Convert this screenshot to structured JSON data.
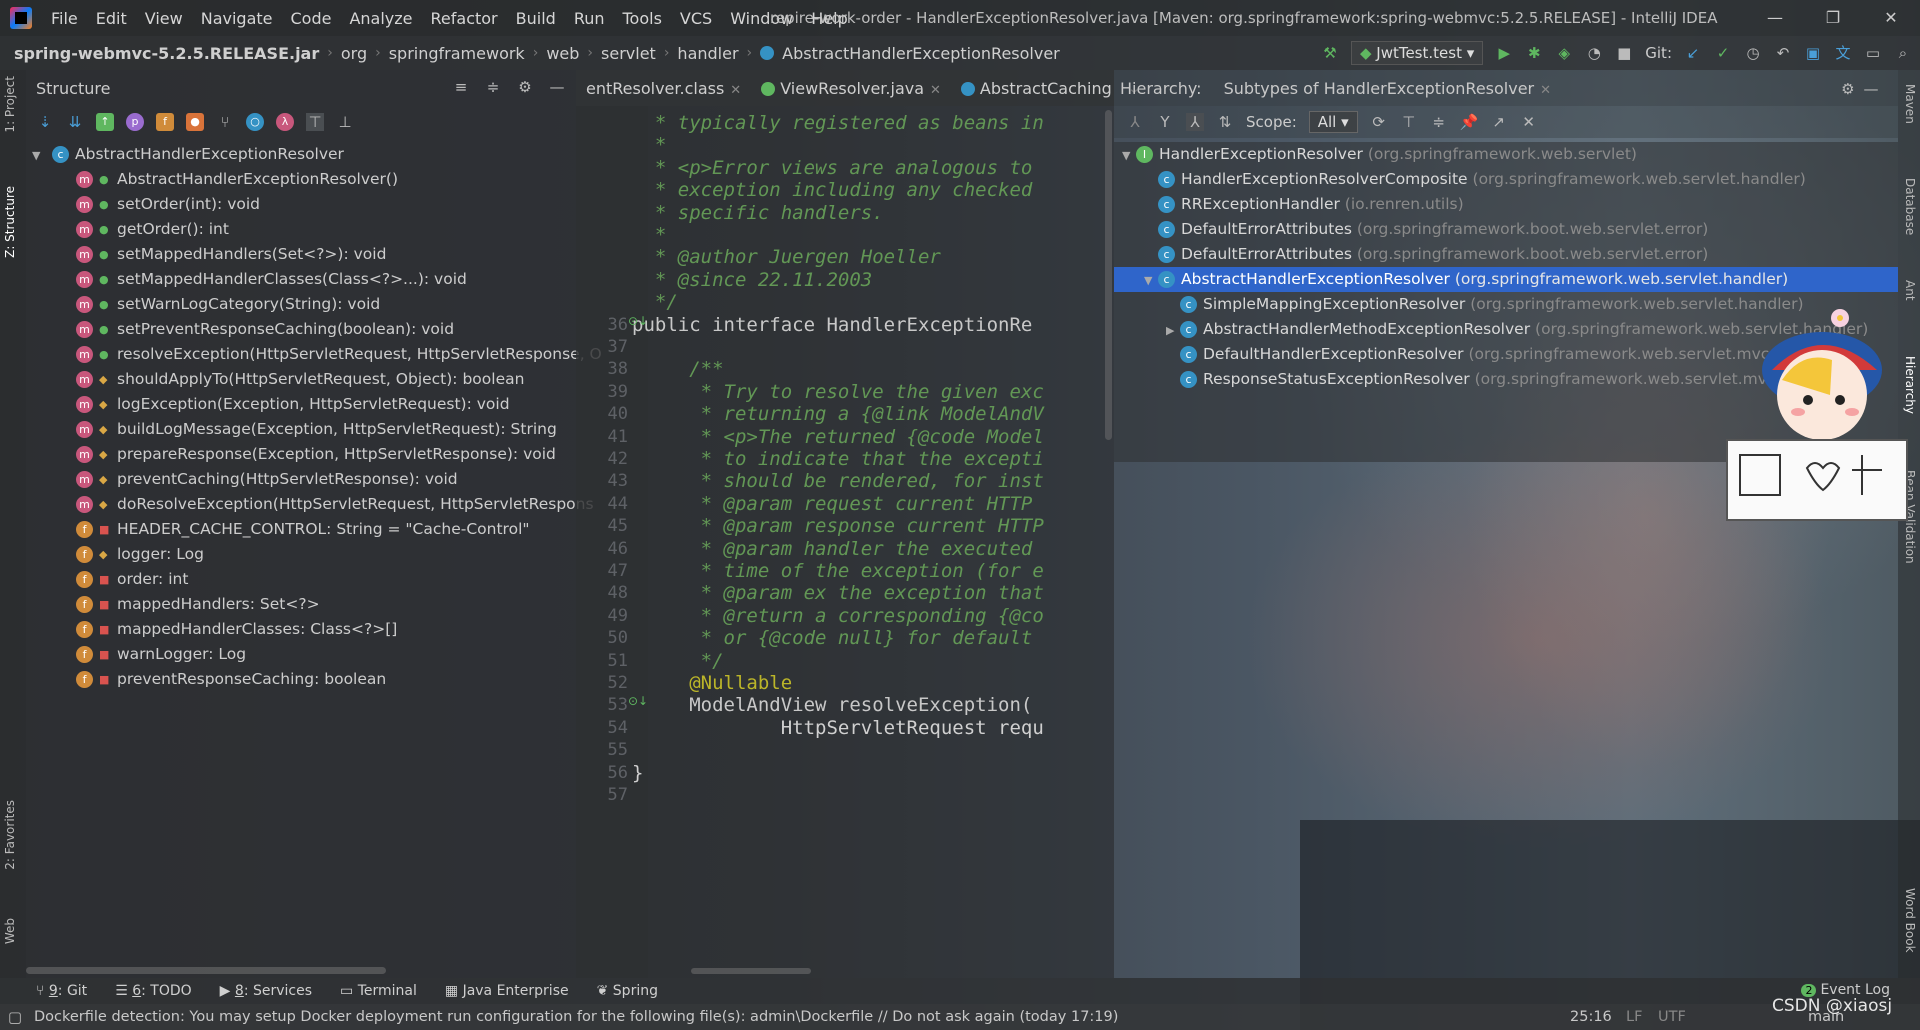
{
  "window": {
    "title": "repire-work-order - HandlerExceptionResolver.java [Maven: org.springframework:spring-webmvc:5.2.5.RELEASE] - IntelliJ IDEA",
    "controls": [
      "—",
      "❐",
      "✕"
    ]
  },
  "menu": [
    "File",
    "Edit",
    "View",
    "Navigate",
    "Code",
    "Analyze",
    "Refactor",
    "Build",
    "Run",
    "Tools",
    "VCS",
    "Window",
    "Help"
  ],
  "breadcrumb": [
    "spring-webmvc-5.2.5.RELEASE.jar",
    "org",
    "springframework",
    "web",
    "servlet",
    "handler",
    "AbstractHandlerExceptionResolver"
  ],
  "toolbar": {
    "run_config": "JwtTest.test",
    "git_label": "Git:"
  },
  "left_stripe": {
    "project": "1: Project",
    "structure": "Z: Structure",
    "favorites": "2: Favorites",
    "web": "Web"
  },
  "right_stripe": {
    "maven": "Maven",
    "database": "Database",
    "ant": "Ant",
    "hierarchy": "Hierarchy",
    "bean_validation": "Bean Validation",
    "word_book": "Word Book"
  },
  "structure": {
    "title": "Structure",
    "root": "AbstractHandlerExceptionResolver",
    "members": [
      {
        "kind": "m",
        "vis": "pub",
        "text": "AbstractHandlerExceptionResolver()"
      },
      {
        "kind": "m",
        "vis": "pub",
        "text": "setOrder(int): void"
      },
      {
        "kind": "m",
        "vis": "pub",
        "text": "getOrder(): int"
      },
      {
        "kind": "m",
        "vis": "pub",
        "text": "setMappedHandlers(Set<?>): void"
      },
      {
        "kind": "m",
        "vis": "pub",
        "text": "setMappedHandlerClasses(Class<?>...): void"
      },
      {
        "kind": "m",
        "vis": "pub",
        "text": "setWarnLogCategory(String): void"
      },
      {
        "kind": "m",
        "vis": "pub",
        "text": "setPreventResponseCaching(boolean): void"
      },
      {
        "kind": "m",
        "vis": "pub",
        "text": "resolveException(HttpServletRequest, HttpServletResponse, O"
      },
      {
        "kind": "m",
        "vis": "pro",
        "text": "shouldApplyTo(HttpServletRequest, Object): boolean"
      },
      {
        "kind": "m",
        "vis": "pro",
        "text": "logException(Exception, HttpServletRequest): void"
      },
      {
        "kind": "m",
        "vis": "pro",
        "text": "buildLogMessage(Exception, HttpServletRequest): String"
      },
      {
        "kind": "m",
        "vis": "pro",
        "text": "prepareResponse(Exception, HttpServletResponse): void"
      },
      {
        "kind": "m",
        "vis": "pro",
        "text": "preventCaching(HttpServletResponse): void"
      },
      {
        "kind": "m",
        "vis": "pro",
        "text": "doResolveException(HttpServletRequest, HttpServletRespons"
      },
      {
        "kind": "f",
        "vis": "pri",
        "text": "HEADER_CACHE_CONTROL: String = \"Cache-Control\""
      },
      {
        "kind": "f",
        "vis": "pro",
        "text": "logger: Log"
      },
      {
        "kind": "f",
        "vis": "pri",
        "text": "order: int"
      },
      {
        "kind": "f",
        "vis": "pri",
        "text": "mappedHandlers: Set<?>"
      },
      {
        "kind": "f",
        "vis": "pri",
        "text": "mappedHandlerClasses: Class<?>[]"
      },
      {
        "kind": "f",
        "vis": "pri",
        "text": "warnLogger: Log"
      },
      {
        "kind": "f",
        "vis": "pri",
        "text": "preventResponseCaching: boolean"
      }
    ]
  },
  "editor": {
    "tabs": [
      {
        "label": "entResolver.class",
        "active": false
      },
      {
        "label": "ViewResolver.java",
        "active": false
      },
      {
        "label": "AbstractCaching",
        "active": false
      }
    ],
    "lines": [
      {
        "n": "",
        "t": "  * typically registered as beans in",
        "c": "cmt"
      },
      {
        "n": "",
        "t": "  *",
        "c": "cmt"
      },
      {
        "n": "",
        "t": "  * <p>Error views are analogous to",
        "c": "cmt"
      },
      {
        "n": "",
        "t": "  * exception including any checked",
        "c": "cmt"
      },
      {
        "n": "",
        "t": "  * specific handlers.",
        "c": "cmt"
      },
      {
        "n": "",
        "t": "  *",
        "c": "cmt"
      },
      {
        "n": "",
        "t": "  * @author Juergen Hoeller",
        "c": "cmt"
      },
      {
        "n": "",
        "t": "  * @since 22.11.2003",
        "c": "cmt"
      },
      {
        "n": "",
        "t": "  */",
        "c": "cmt"
      },
      {
        "n": "36",
        "t": "public interface HandlerExceptionRe",
        "c": "decl"
      },
      {
        "n": "37",
        "t": "",
        "c": "plain"
      },
      {
        "n": "38",
        "t": "     /**",
        "c": "cmt"
      },
      {
        "n": "39",
        "t": "      * Try to resolve the given exc",
        "c": "cmt"
      },
      {
        "n": "40",
        "t": "      * returning a {@link ModelAndV",
        "c": "cmt"
      },
      {
        "n": "41",
        "t": "      * <p>The returned {@code Model",
        "c": "cmt"
      },
      {
        "n": "42",
        "t": "      * to indicate that the excepti",
        "c": "cmt"
      },
      {
        "n": "43",
        "t": "      * should be rendered, for inst",
        "c": "cmt"
      },
      {
        "n": "44",
        "t": "      * @param request current HTTP",
        "c": "cmt"
      },
      {
        "n": "45",
        "t": "      * @param response current HTTP",
        "c": "cmt"
      },
      {
        "n": "46",
        "t": "      * @param handler the executed",
        "c": "cmt"
      },
      {
        "n": "47",
        "t": "      * time of the exception (for e",
        "c": "cmt"
      },
      {
        "n": "48",
        "t": "      * @param ex the exception that",
        "c": "cmt"
      },
      {
        "n": "49",
        "t": "      * @return a corresponding {@co",
        "c": "cmt"
      },
      {
        "n": "50",
        "t": "      * or {@code null} for default",
        "c": "cmt"
      },
      {
        "n": "51",
        "t": "      */",
        "c": "cmt"
      },
      {
        "n": "52",
        "t": "     @Nullable",
        "c": "ann"
      },
      {
        "n": "53",
        "t": "     ModelAndView resolveException(",
        "c": "method"
      },
      {
        "n": "54",
        "t": "             HttpServletRequest requ",
        "c": "plain"
      },
      {
        "n": "55",
        "t": "",
        "c": "plain"
      },
      {
        "n": "56",
        "t": "}",
        "c": "plain"
      },
      {
        "n": "57",
        "t": "",
        "c": "plain"
      }
    ]
  },
  "hierarchy": {
    "label": "Hierarchy:",
    "tab": "Subtypes of HandlerExceptionResolver",
    "scope_label": "Scope:",
    "scope_value": "All",
    "rows": [
      {
        "level": 0,
        "arrow": "▼",
        "name": "HandlerExceptionResolver",
        "pkg": "(org.springframework.web.servlet)",
        "kind": "i",
        "selected": false
      },
      {
        "level": 1,
        "arrow": "",
        "name": "HandlerExceptionResolverComposite",
        "pkg": "(org.springframework.web.servlet.handler)",
        "kind": "c",
        "selected": false
      },
      {
        "level": 1,
        "arrow": "",
        "name": "RRExceptionHandler",
        "pkg": "(io.renren.utils)",
        "kind": "c",
        "selected": false
      },
      {
        "level": 1,
        "arrow": "",
        "name": "DefaultErrorAttributes",
        "pkg": "(org.springframework.boot.web.servlet.error)",
        "kind": "c",
        "selected": false
      },
      {
        "level": 1,
        "arrow": "",
        "name": "DefaultErrorAttributes",
        "pkg": "(org.springframework.boot.web.servlet.error)",
        "kind": "c",
        "selected": false
      },
      {
        "level": 1,
        "arrow": "▼",
        "name": "AbstractHandlerExceptionResolver",
        "pkg": "(org.springframework.web.servlet.handler)",
        "kind": "c",
        "selected": true
      },
      {
        "level": 2,
        "arrow": "",
        "name": "SimpleMappingExceptionResolver",
        "pkg": "(org.springframework.web.servlet.handler)",
        "kind": "c",
        "selected": false
      },
      {
        "level": 2,
        "arrow": "▶",
        "name": "AbstractHandlerMethodExceptionResolver",
        "pkg": "(org.springframework.web.servlet.handler)",
        "kind": "c",
        "selected": false
      },
      {
        "level": 2,
        "arrow": "",
        "name": "DefaultHandlerExceptionResolver",
        "pkg": "(org.springframework.web.servlet.mvc.su",
        "kind": "c",
        "selected": false
      },
      {
        "level": 2,
        "arrow": "",
        "name": "ResponseStatusExceptionResolver",
        "pkg": "(org.springframework.web.servlet.mvc",
        "kind": "c",
        "selected": false
      }
    ]
  },
  "bottom_tools": [
    {
      "num": "9",
      "label": ": Git"
    },
    {
      "num": "6",
      "label": ": TODO"
    },
    {
      "num": "8",
      "label": ": Services"
    },
    {
      "num": "",
      "label": "Terminal"
    },
    {
      "num": "",
      "label": "Java Enterprise"
    },
    {
      "num": "",
      "label": "Spring"
    }
  ],
  "status": {
    "message": "Dockerfile detection: You may setup Docker deployment run configuration for the following file(s): admin\\Dockerfile // Do not ask again (today 17:19)",
    "position": "25:16",
    "line_sep": "LF",
    "encoding": "UTF",
    "event_log": "Event Log",
    "event_count": "2",
    "watermark": "CSDN @xiaosj",
    "branch": "main"
  },
  "colors": {
    "accent_selection": "#2f65ca",
    "comment": "#629755",
    "keyword": "#cc7832",
    "annotation": "#bbb529",
    "method": "#ffc66d"
  }
}
